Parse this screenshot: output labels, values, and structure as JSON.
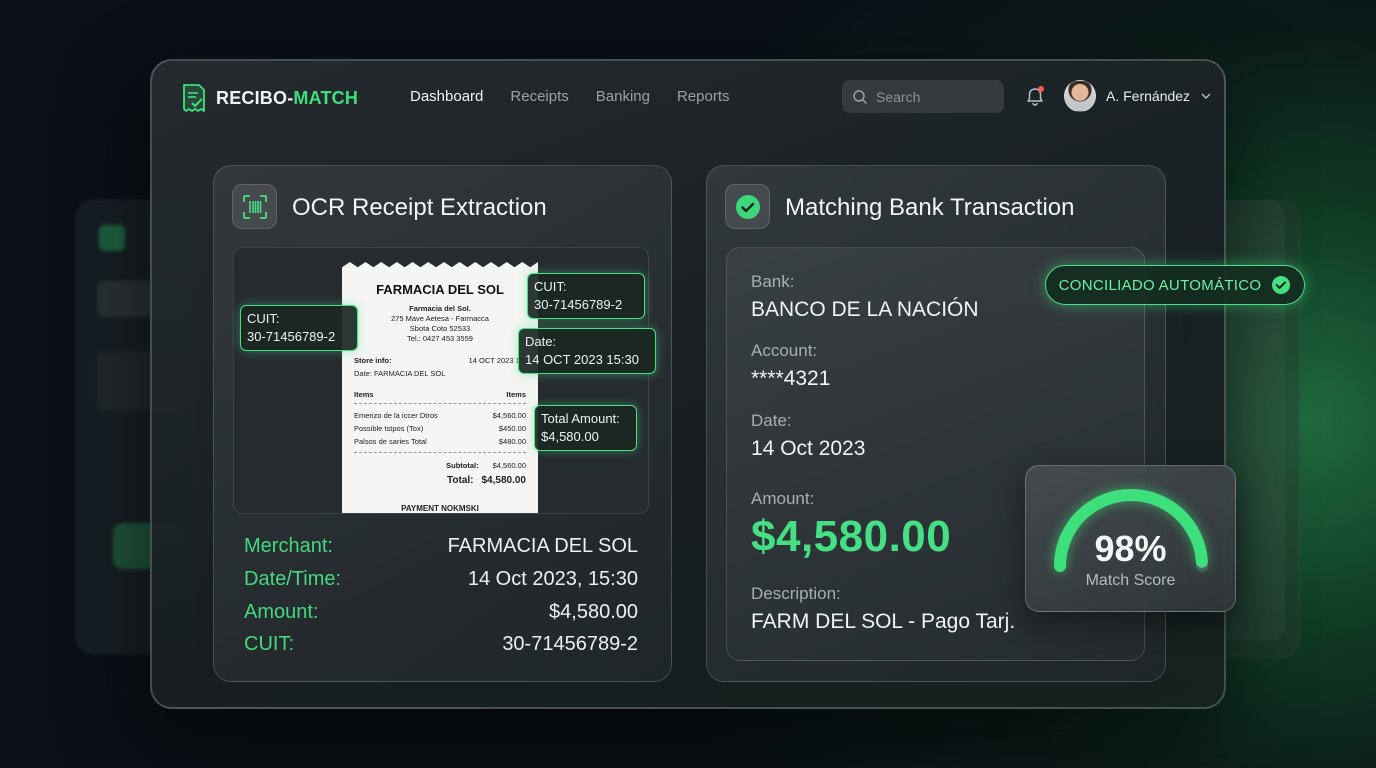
{
  "app": {
    "logo_prefix": "RECIBO-",
    "logo_suffix": "MATCH",
    "nav": [
      "Dashboard",
      "Receipts",
      "Banking",
      "Reports"
    ],
    "active_nav": "Dashboard",
    "search_placeholder": "Search",
    "user_name": "A. Fernández",
    "accent_color": "#45e084"
  },
  "ocr_card": {
    "title": "OCR Receipt Extraction",
    "icon": "barcode-scan-icon",
    "receipt": {
      "store": "FARMACIA DEL SOL",
      "lines": [
        "Farmacia del Sol.",
        "275 Mave Aetesa - Farmacca",
        "Sbota Coto 52533",
        "Tel.: 0427 453 3559"
      ],
      "store_info_label": "Store info:",
      "store_info_value": "14 OCT 2023 15:",
      "date_row": "Date: FARMACIA DEL SOL",
      "items_header_left": "Items",
      "items_header_right": "Items",
      "items": [
        {
          "name": "Emerizo de la iccer Dtros",
          "price": "$4,560.00"
        },
        {
          "name": "Possible tstpos (Tox)",
          "price": "$450.00"
        },
        {
          "name": "Palsos de saries Total",
          "price": "$480.00"
        }
      ],
      "subtotal_label": "Subtotal:",
      "subtotal_value": "$4,560.00",
      "total_label": "Total:",
      "total_value": "$4,580.00",
      "footer": "PAYMENT NOKMSKI"
    },
    "tags": {
      "cuit_left_label": "CUIT:",
      "cuit_left_value": "30-71456789-2",
      "cuit_right_label": "CUIT:",
      "cuit_right_value": "30-71456789-2",
      "date_label": "Date:",
      "date_value": "14 OCT 2023 15:30",
      "total_label": "Total Amount:",
      "total_value": "$4,580.00"
    },
    "extracted": [
      {
        "key": "Merchant:",
        "value": "FARMACIA DEL SOL"
      },
      {
        "key": "Date/Time:",
        "value": "14 Oct 2023, 15:30"
      },
      {
        "key": "Amount:",
        "value": "$4,580.00"
      },
      {
        "key": "CUIT:",
        "value": "30-71456789-2"
      }
    ]
  },
  "bank_card": {
    "title": "Matching Bank Transaction",
    "icon": "check-circle-icon",
    "bank_label": "Bank:",
    "bank_value": "BANCO DE LA NACIÓN",
    "account_label": "Account:",
    "account_value": "****4321",
    "date_label": "Date:",
    "date_value": "14 Oct 2023",
    "amount_label": "Amount:",
    "amount_value": "$4,580.00",
    "description_label": "Description:",
    "description_value": "FARM DEL SOL - Pago Tarj.",
    "badge": "CONCILIADO AUTOMÁTICO",
    "match_score_value": "98%",
    "match_score_fraction": 0.98,
    "match_score_label": "Match Score"
  }
}
